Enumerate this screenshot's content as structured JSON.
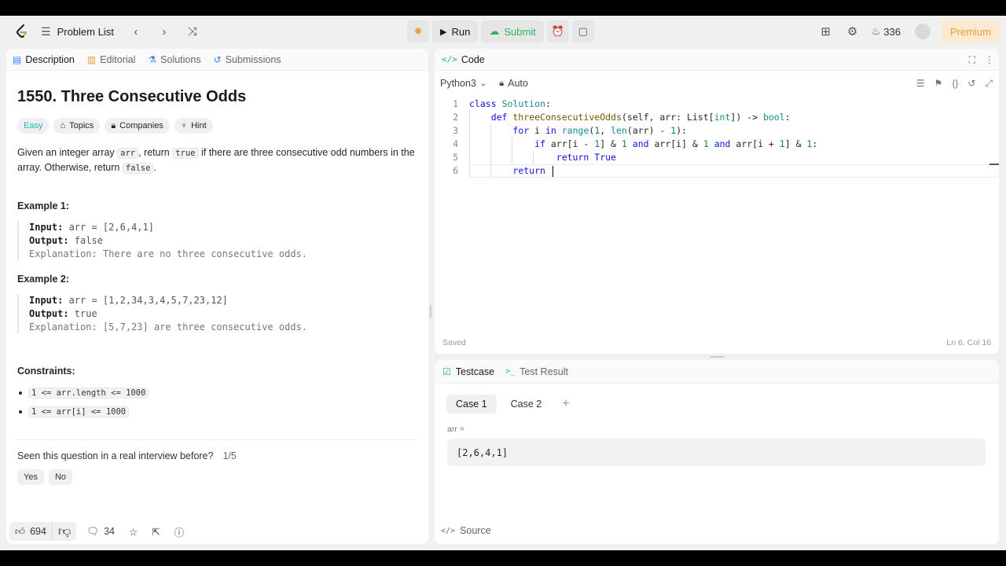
{
  "topbar": {
    "problem_list": "Problem List",
    "run": "Run",
    "submit": "Submit",
    "streak": "336",
    "premium": "Premium"
  },
  "left": {
    "tabs": [
      "Description",
      "Editorial",
      "Solutions",
      "Submissions"
    ],
    "title": "1550. Three Consecutive Odds",
    "tags": [
      "Easy",
      "Topics",
      "Companies",
      "Hint"
    ],
    "desc": {
      "p1": "Given an integer array ",
      "c1": "arr",
      "p2": ", return ",
      "c2": "true",
      "p3": " if there are three consecutive odd numbers in the array. Otherwise, return ",
      "c3": "false",
      "p4": "."
    },
    "examples": [
      {
        "heading": "Example 1:",
        "input_label": "Input:",
        "input": " arr = [2,6,4,1]",
        "output_label": "Output:",
        "output": " false",
        "explanation": "Explanation: There are no three consecutive odds."
      },
      {
        "heading": "Example 2:",
        "input_label": "Input:",
        "input": " arr = [1,2,34,3,4,5,7,23,12]",
        "output_label": "Output:",
        "output": " true",
        "explanation": "Explanation: [5,7,23] are three consecutive odds."
      }
    ],
    "constraints_heading": "Constraints:",
    "constraints": [
      "1 <= arr.length <= 1000",
      "1 <= arr[i] <= 1000"
    ],
    "seen_question": "Seen this question in a real interview before?",
    "seen_count": "1/5",
    "yes": "Yes",
    "no": "No",
    "likes": "694",
    "comments": "34"
  },
  "code": {
    "title": "Code",
    "language": "Python3",
    "mode": "Auto",
    "status": "Saved",
    "cursor": "Ln 6, Col 16",
    "line_numbers": [
      "1",
      "2",
      "3",
      "4",
      "5",
      "6"
    ],
    "lines": [
      "class Solution:",
      "    def threeConsecutiveOdds(self, arr: List[int]) -> bool:",
      "        for i in range(1, len(arr) - 1):",
      "            if arr[i - 1] & 1 and arr[i] & 1 and arr[i + 1] & 1:",
      "                return True",
      "        return "
    ]
  },
  "test": {
    "tabs": [
      "Testcase",
      "Test Result"
    ],
    "cases": [
      "Case 1",
      "Case 2"
    ],
    "var_label": "arr =",
    "var_value": "[2,6,4,1]",
    "source": "Source"
  }
}
